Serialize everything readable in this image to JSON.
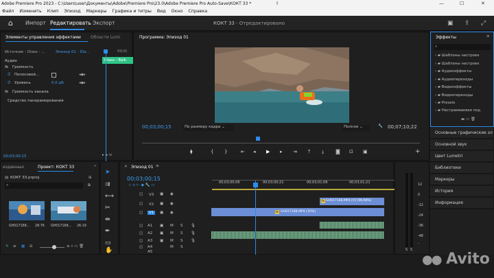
{
  "window": {
    "title": "Adobe Premiere Pro 2023 - C:\\Users\\user\\Документы\\Adobe\\Premiere Pro\\23.0\\Adobe Premiere Pro Auto-Save\\КОКТ 33 *"
  },
  "menu": [
    "Файл",
    "Изменить",
    "Клип",
    "Эпизод",
    "Маркеры",
    "Графика и титры",
    "Вид",
    "Окно",
    "Справка"
  ],
  "workspaces": {
    "import": "Импорт",
    "edit": "Редактировать",
    "export": "Экспорт",
    "project_title": "КОКТ 33",
    "status": "- Отредактировано"
  },
  "effect_controls": {
    "tab_label": "Элементы управления эффектами",
    "tab2": "Области Lumi",
    "source_label": "Источник - Diass - ...",
    "sequence_label": "Эпизод 01 - Dia...",
    "time_marker": "00;0(",
    "clip_name": "Diass - Balk",
    "audio": "Аудио",
    "fx_volume": "Громкость",
    "bypass": "Полосовой...",
    "level": "Уровень",
    "level_value": "0,0 дБ",
    "channel_volume": "Громкость канала",
    "panner": "Средство панорамирования",
    "timecode": "00;03;00;15"
  },
  "program": {
    "title": "Программа: Эпизод 01",
    "timecode": "00;03;00;15",
    "fit": "По размеру кадра",
    "quality": "Полное",
    "duration": "00;07;10;22"
  },
  "effects": {
    "title": "Эффекты",
    "items": [
      "Шаблоны настроек",
      "Шаблоны настроек",
      "Аудиоэффекты",
      "Аудиопереходы",
      "Видеоэффекты",
      "Видеопереходы",
      "Presets",
      "Настраиваемая под"
    ]
  },
  "right_panels": [
    "Основные графические эл",
    "Основной звук",
    "Цвет Lumetri",
    "Библиотеки",
    "Маркеры",
    "История",
    "Информация"
  ],
  "project": {
    "tab1": "изданных",
    "tab2": "Проект: КОКТ 33",
    "file": "КОКТ 33.prproj",
    "clips": [
      {
        "name": "GH017168...",
        "dur": "28:76"
      },
      {
        "name": "GH017168...",
        "dur": "26:19"
      }
    ]
  },
  "timeline": {
    "title": "Эпизод 01",
    "timecode": "00;03;00;15",
    "ruler": [
      "00;03;00;06",
      "00;03;00;21",
      "00;03;01;06",
      "00;03;01;21"
    ],
    "tracks": [
      "V3",
      "V2",
      "V1",
      "A1",
      "A2",
      "A3",
      "A4",
      "A5",
      "A6"
    ],
    "clips": {
      "v2": "GH017168.MP4 [V] [99,98%]",
      "v1": "GH017168.MP4 [30%]"
    },
    "meter_labels": [
      "12",
      "0",
      "-12",
      "-24",
      "-36",
      "-48",
      "-"
    ],
    "meter_bottom": [
      "S",
      "S"
    ]
  },
  "watermark": "Avito"
}
